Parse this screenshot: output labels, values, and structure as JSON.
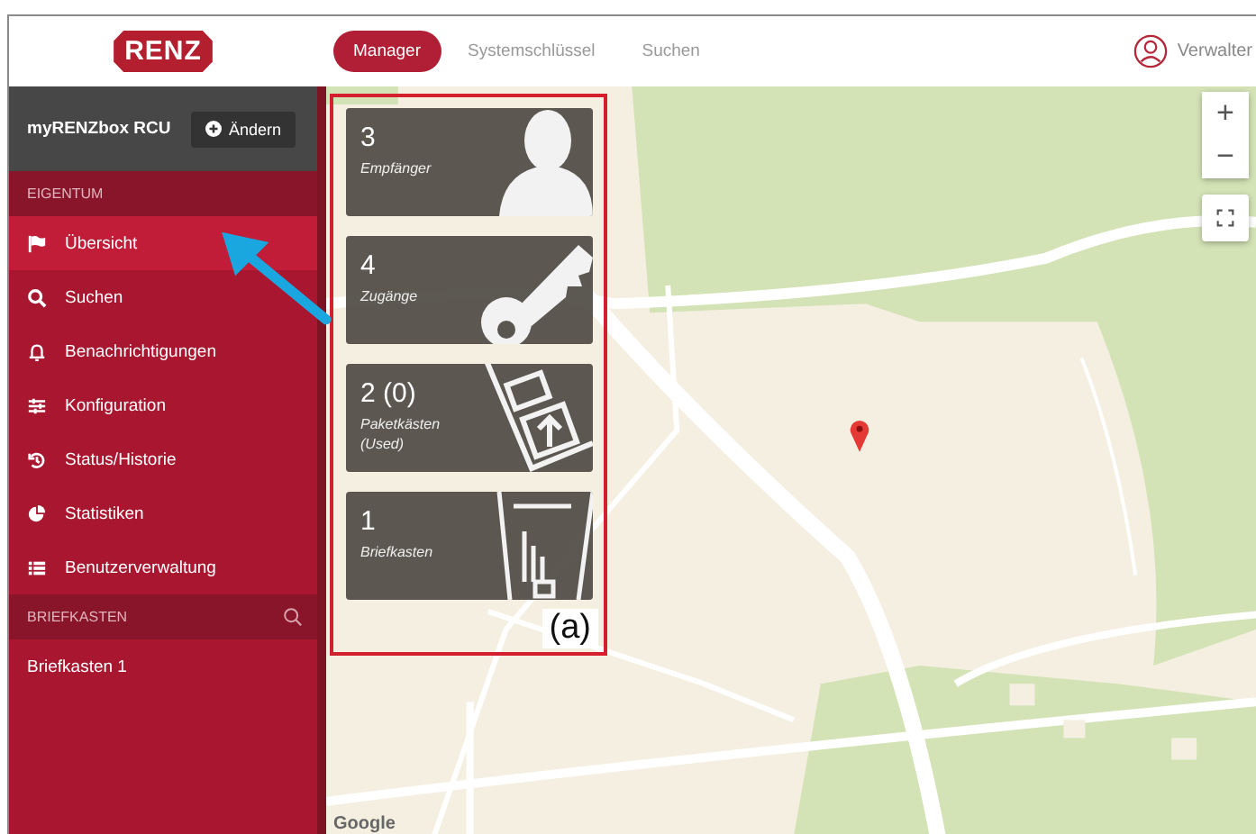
{
  "header": {
    "logo": "RENZ",
    "nav": [
      {
        "label": "Manager",
        "selected": true
      },
      {
        "label": "Systemschlüssel",
        "selected": false
      },
      {
        "label": "Suchen",
        "selected": false
      }
    ],
    "user": "Verwalter"
  },
  "sidebar": {
    "device": "myRENZbox RCU",
    "change_button": "Ändern",
    "sections": [
      {
        "title": "EIGENTUM",
        "search": false,
        "items": [
          {
            "label": "Übersicht",
            "kind": "flag",
            "selected": true
          },
          {
            "label": "Suchen",
            "kind": "search",
            "selected": false
          },
          {
            "label": "Benachrichtigungen",
            "kind": "bell",
            "selected": false
          },
          {
            "label": "Konfiguration",
            "kind": "sliders",
            "selected": false
          },
          {
            "label": "Status/Historie",
            "kind": "history",
            "selected": false
          },
          {
            "label": "Statistiken",
            "kind": "pie",
            "selected": false
          },
          {
            "label": "Benutzerverwaltung",
            "kind": "list",
            "selected": false
          }
        ]
      },
      {
        "title": "BRIEFKASTEN",
        "search": true,
        "items": [
          {
            "label": "Briefkasten 1",
            "kind": "plain",
            "selected": false
          }
        ]
      }
    ]
  },
  "tiles": [
    {
      "count": "3",
      "label": "Empfänger",
      "kind": "person"
    },
    {
      "count": "4",
      "label": "Zugänge",
      "kind": "key"
    },
    {
      "count": "2 (0)",
      "label": "Paketkästen (Used)",
      "kind": "parcel"
    },
    {
      "count": "1",
      "label": "Briefkasten",
      "kind": "mailbox"
    }
  ],
  "map": {
    "zoom_in": "+",
    "zoom_out": "−",
    "logo": "Google"
  },
  "annotation": {
    "label": "(a)"
  }
}
